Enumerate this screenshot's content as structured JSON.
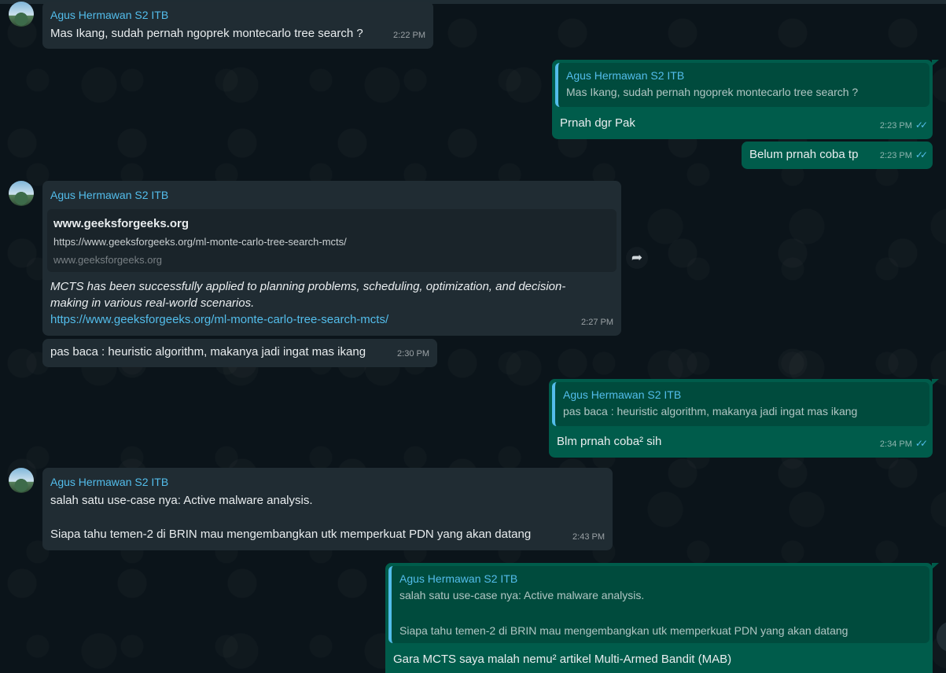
{
  "messages": {
    "m1": {
      "sender": "Agus Hermawan S2 ITB",
      "text": "Mas Ikang, sudah pernah ngoprek montecarlo tree search ?",
      "time": "2:22 PM"
    },
    "m2": {
      "quote_sender": "Agus Hermawan S2 ITB",
      "quote_text": "Mas Ikang, sudah pernah ngoprek montecarlo tree search ?",
      "text": "Prnah dgr Pak",
      "time": "2:23 PM"
    },
    "m3": {
      "text": "Belum prnah coba tp",
      "time": "2:23 PM"
    },
    "m4": {
      "sender": "Agus Hermawan S2 ITB",
      "link_title": "www.geeksforgeeks.org",
      "link_url": "https://www.geeksforgeeks.org/ml-monte-carlo-tree-search-mcts/",
      "link_domain": "www.geeksforgeeks.org",
      "text_line1": "MCTS has been successfully applied to planning problems, scheduling, optimization, and decision-",
      "text_line2": "making in various real-world scenarios.",
      "link": "https://www.geeksforgeeks.org/ml-monte-carlo-tree-search-mcts/",
      "time": "2:27 PM"
    },
    "m5": {
      "text": "pas baca : heuristic algorithm, makanya jadi ingat mas ikang",
      "time": "2:30 PM"
    },
    "m6": {
      "quote_sender": "Agus Hermawan S2 ITB",
      "quote_text": "pas baca : heuristic algorithm, makanya jadi ingat mas ikang",
      "text": "Blm prnah coba² sih",
      "time": "2:34 PM"
    },
    "m7": {
      "sender": "Agus Hermawan S2 ITB",
      "line1": "salah satu use-case nya: Active malware analysis.",
      "line2": "Siapa tahu temen-2 di BRIN mau mengembangkan utk memperkuat PDN yang akan datang",
      "time": "2:43 PM"
    },
    "m8": {
      "quote_sender": "Agus Hermawan S2 ITB",
      "quote_line1": "salah satu use-case nya: Active malware analysis.",
      "quote_line2": "Siapa tahu temen-2 di BRIN mau mengembangkan utk memperkuat PDN yang akan datang",
      "text": "Gara MCTS saya malah nemu² artikel Multi-Armed Bandit (MAB)"
    }
  },
  "icons": {
    "read_ticks": "✓✓",
    "forward": "➦"
  },
  "colors": {
    "incoming": "#202c33",
    "outgoing": "#005c4b",
    "sender": "#53bdeb",
    "background": "#0b141a"
  }
}
